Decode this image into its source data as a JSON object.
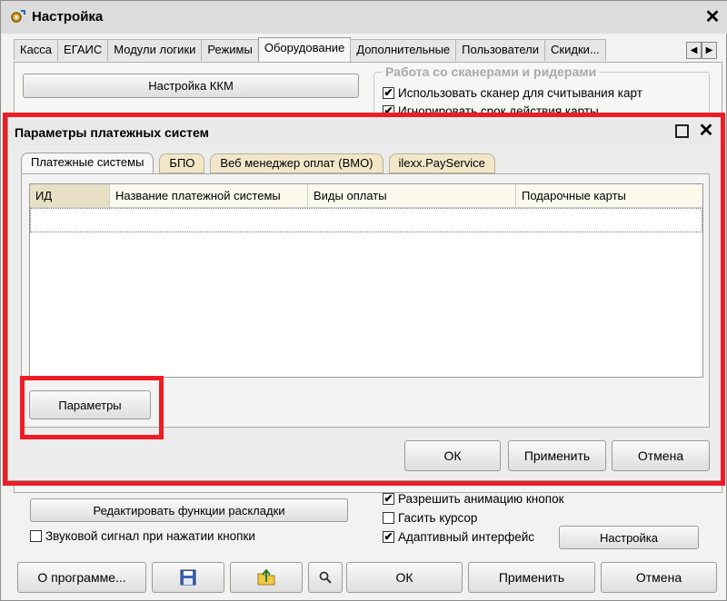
{
  "outer": {
    "title": "Настройка",
    "tabs": [
      "Касса",
      "ЕГАИС",
      "Модули логики",
      "Режимы",
      "Оборудование",
      "Дополнительные",
      "Пользователи",
      "Скидки..."
    ],
    "active_tab": "Оборудование",
    "kkm_button": "Настройка ККМ",
    "scanners_group": "Работа со сканерами и ридерами",
    "check_scanner": "Использовать сканер для считывания карт",
    "check_ignore": "Игнорировать срок действия карты",
    "edit_layout_button": "Редактировать функции раскладки",
    "sound_check": "Звуковой сигнал при нажатии кнопки",
    "anim_check": "Разрешить анимацию кнопок",
    "cursor_check": "Гасить курсор",
    "adaptive_check": "Адаптивный интерфейс",
    "adaptive_settings_button": "Настройка",
    "footer": {
      "about": "О программе...",
      "ok": "ОК",
      "apply": "Применить",
      "cancel": "Отмена"
    },
    "checks": {
      "scanner": true,
      "ignore": true,
      "sound": false,
      "anim": true,
      "cursor": false,
      "adaptive": true
    }
  },
  "modal": {
    "title": "Параметры платежных систем",
    "tabs": [
      "Платежные системы",
      "БПО",
      "Веб менеджер оплат (ВМО)",
      "ilexx.PayService"
    ],
    "columns": [
      "ИД",
      "Название платежной системы",
      "Виды оплаты",
      "Подарочные карты"
    ],
    "params_button": "Параметры",
    "ok": "ОК",
    "apply": "Применить",
    "cancel": "Отмена"
  },
  "highlight_color": "#ee1c25"
}
